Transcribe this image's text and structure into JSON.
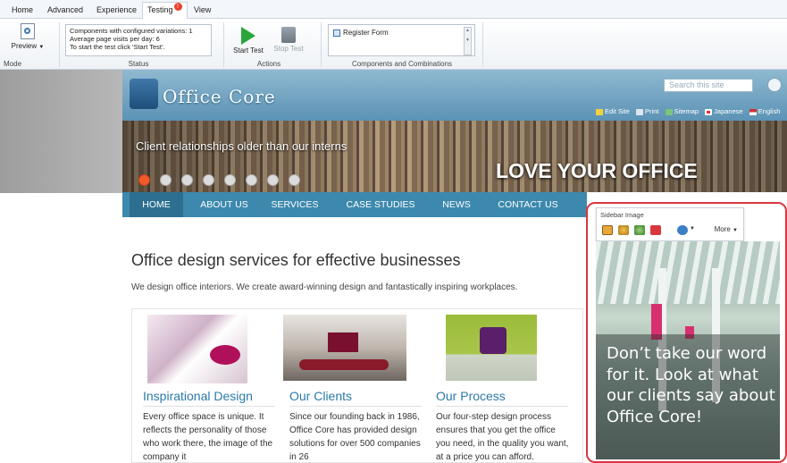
{
  "ribbon": {
    "tabs": [
      "Home",
      "Advanced",
      "Experience",
      "Testing",
      "View"
    ],
    "testing_badge": "!",
    "preview_label": "Preview",
    "mode_label": "Mode",
    "status_lines": [
      "Components with configured variations: 1",
      "Average page visits per day: 6",
      "To start the test click 'Start Test'."
    ],
    "status_label": "Status",
    "start_test": "Start Test",
    "stop_test": "Stop Test",
    "actions_label": "Actions",
    "component_item": "Register Form",
    "components_label": "Components and Combinations"
  },
  "site": {
    "logo": "Office Core",
    "search_placeholder": "Search this site",
    "top_links": [
      "Edit Site",
      "Print",
      "Sitemap",
      "Japanese",
      "English"
    ],
    "tagline": "Client relationships older than our interns",
    "banner_text": "LOVE YOUR OFFICE",
    "nav": [
      "HOME",
      "ABOUT US",
      "SERVICES",
      "CASE STUDIES",
      "NEWS",
      "CONTACT US"
    ],
    "heading": "Office design services for effective businesses",
    "intro": "We design office interiors. We create award-winning design and fantastically inspiring workplaces.",
    "cards": [
      {
        "title": "Inspirational Design",
        "body": "Every office space is unique. It reflects the personality of those who work there, the image of the company it"
      },
      {
        "title": "Our Clients",
        "body": "Since our founding back in 1986, Office Core has provided design solutions for over 500 companies in 26"
      },
      {
        "title": "Our Process",
        "body": "Our four-step design process ensures that you get the office you need, in the quality you want, at a price you can afford."
      }
    ]
  },
  "sidebar": {
    "toolbar_label": "Sidebar Image",
    "more": "More",
    "quote": "Don’t take our word for it. Look at what our clients say about Office Core!"
  },
  "colors": {
    "nav": "#3d89ad",
    "accent": "#2c7aa8",
    "highlight_border": "#d9363e"
  }
}
